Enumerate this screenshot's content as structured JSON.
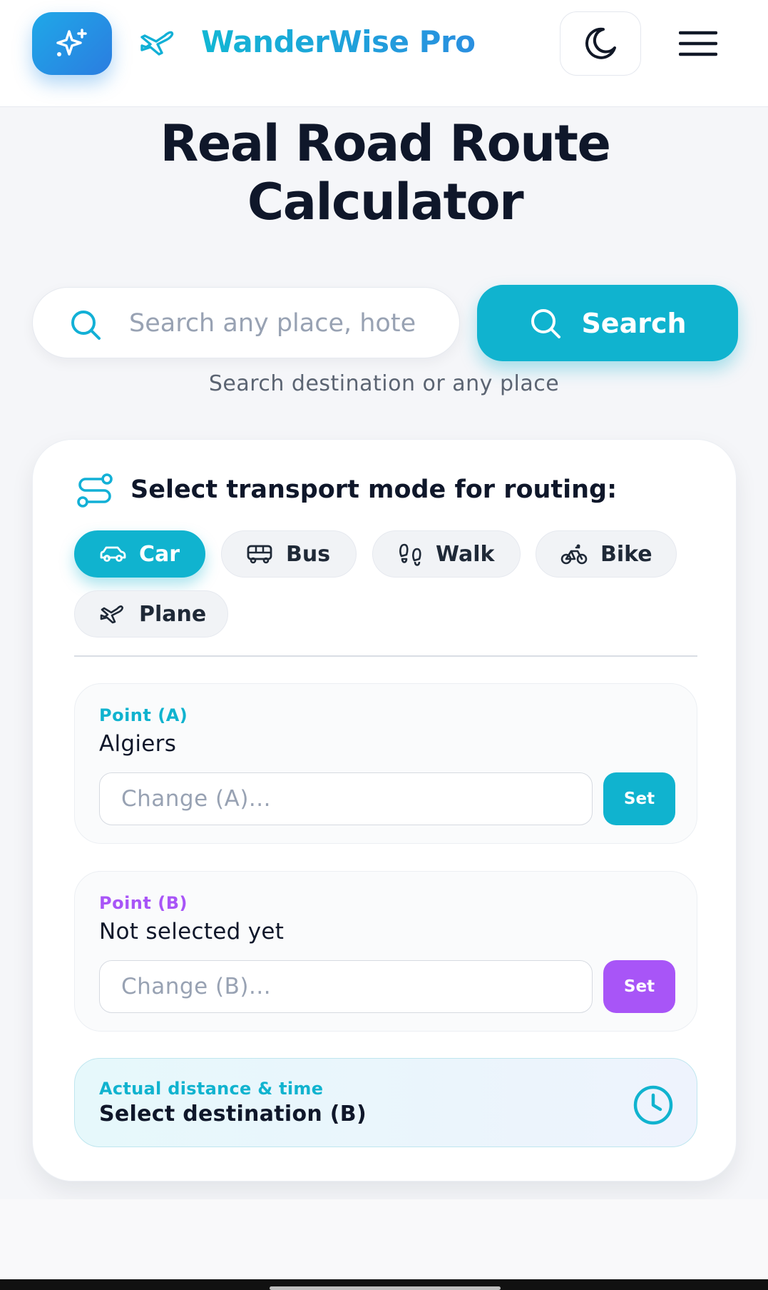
{
  "header": {
    "brand_name": "WanderWise Pro"
  },
  "page": {
    "title_line1": "Real Road Route",
    "title_line2": "Calculator"
  },
  "search": {
    "placeholder": "Search any place, hote",
    "button_label": "Search",
    "hint": "Search destination or any place"
  },
  "transport": {
    "heading": "Select transport mode for routing:",
    "modes": [
      {
        "label": "Car",
        "icon": "car-icon",
        "active": true
      },
      {
        "label": "Bus",
        "icon": "bus-icon",
        "active": false
      },
      {
        "label": "Walk",
        "icon": "footprints-icon",
        "active": false
      },
      {
        "label": "Bike",
        "icon": "bike-icon",
        "active": false
      },
      {
        "label": "Plane",
        "icon": "plane-icon",
        "active": false
      }
    ]
  },
  "point_a": {
    "label": "Point (A)",
    "value": "Algiers",
    "placeholder": "Change (A)...",
    "set_label": "Set"
  },
  "point_b": {
    "label": "Point (B)",
    "value": "Not selected yet",
    "placeholder": "Change (B)...",
    "set_label": "Set"
  },
  "result": {
    "label": "Actual distance & time",
    "value": "Select destination (B)"
  },
  "colors": {
    "accent_cyan": "#10b3cf",
    "accent_purple": "#a855f7",
    "brand_blue": "#2b7de0",
    "text_dark": "#0f172a"
  }
}
